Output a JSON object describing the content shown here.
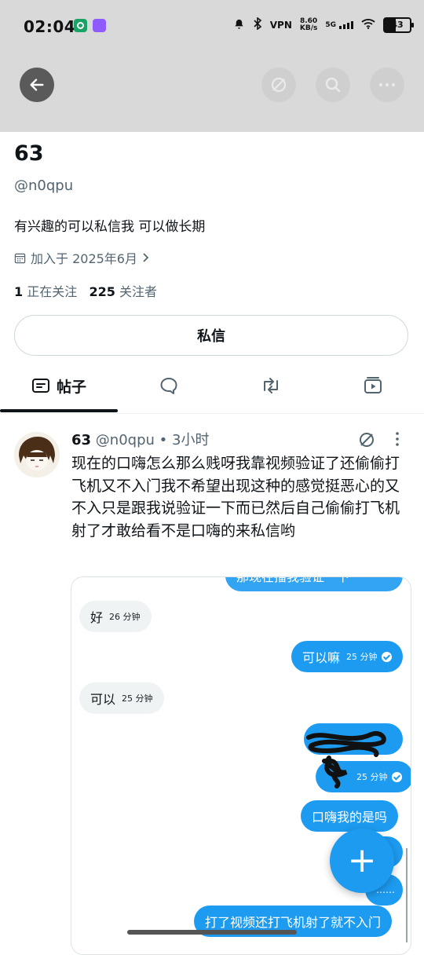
{
  "status_bar": {
    "time": "02:04",
    "vpn": "VPN",
    "speed_value": "8.60",
    "speed_unit": "KB/s",
    "network": "5G",
    "battery": "43"
  },
  "profile": {
    "display_name": "63",
    "handle": "@n0qpu",
    "bio": "有兴趣的可以私信我 可以做长期",
    "joined": "加入于 2025年6月",
    "following_count": "1",
    "following_label": "正在关注",
    "followers_count": "225",
    "followers_label": "关注者",
    "dm_button": "私信"
  },
  "tabs": {
    "posts_label": "帖子"
  },
  "post": {
    "author": "63",
    "handle": "@n0qpu",
    "separator": "•",
    "time": "3小时",
    "text": "现在的口嗨怎么那么贱呀我靠视频验证了还偷偷打飞机又不入门我不希望出现这种的感觉挺恶心的又不入只是跟我说验证一下而已然后自己偷偷打飞机射了才敢给看不是口嗨的来私信哟"
  },
  "chat": {
    "top_partial": "那现在播我验证一下",
    "m1_text": "好",
    "m1_time": "26 分钟",
    "m2_text": "可以嘛",
    "m2_time": "25 分钟",
    "m3_text": "可以",
    "m3_time": "25 分钟",
    "m5_time": "25 分钟",
    "m6_text": "口嗨我的是吗",
    "m8_text": "……",
    "m9_text": "打了视频还打飞机射了就不入门"
  },
  "fab": {
    "label": "+"
  },
  "colors": {
    "accent": "#1d9bf0",
    "text": "#0f1419",
    "secondary": "#536471"
  }
}
